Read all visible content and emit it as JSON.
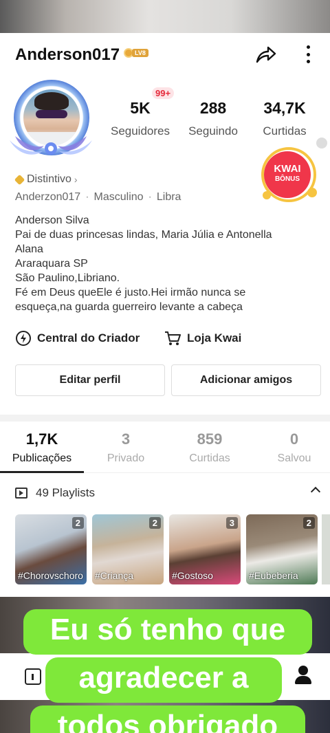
{
  "profile": {
    "username": "Anderson017",
    "level_badge": "LV8",
    "notification_badge": "99+",
    "stats": [
      {
        "value": "5K",
        "label": "Seguidores"
      },
      {
        "value": "288",
        "label": "Seguindo"
      },
      {
        "value": "34,7K",
        "label": "Curtidas"
      }
    ],
    "kwai_bonus": {
      "line1": "KWAI",
      "line2": "BÔNUS"
    },
    "distintivo": "Distintivo",
    "meta": [
      "Anderzon017",
      "Masculino",
      "Libra"
    ],
    "bio": [
      "Anderson Silva",
      "Pai de duas princesas lindas, Maria Júlia e Antonella",
      "Alana",
      "Araraquara SP",
      "São Paulino,Libriano.",
      "Fé em Deus queEle é justo.Hei irmão nunca se",
      "esqueça,na guarda guerreiro levante a cabeça"
    ]
  },
  "links": {
    "creator_center": "Central do Criador",
    "shop": "Loja Kwai"
  },
  "buttons": {
    "edit_profile": "Editar perfil",
    "add_friends": "Adicionar amigos"
  },
  "tabs": [
    {
      "value": "1,7K",
      "label": "Publicações",
      "active": true
    },
    {
      "value": "3",
      "label": "Privado",
      "active": false
    },
    {
      "value": "859",
      "label": "Curtidas",
      "active": false
    },
    {
      "value": "0",
      "label": "Salvou",
      "active": false
    }
  ],
  "playlists": {
    "title": "49 Playlists",
    "items": [
      {
        "tag": "#Chorovschoro",
        "count": "2"
      },
      {
        "tag": "#Criança",
        "count": "2"
      },
      {
        "tag": "#Gostoso",
        "count": "3"
      },
      {
        "tag": "#Eubeberia",
        "count": "2"
      }
    ]
  },
  "caption": {
    "lines": [
      "Eu só tenho que",
      "agradecer a",
      "todos obrigado"
    ]
  },
  "colors": {
    "caption_bg": "#7fe83a",
    "notif_red": "#e5293a",
    "kwai_red": "#f0364a",
    "gold": "#e8a93a"
  }
}
